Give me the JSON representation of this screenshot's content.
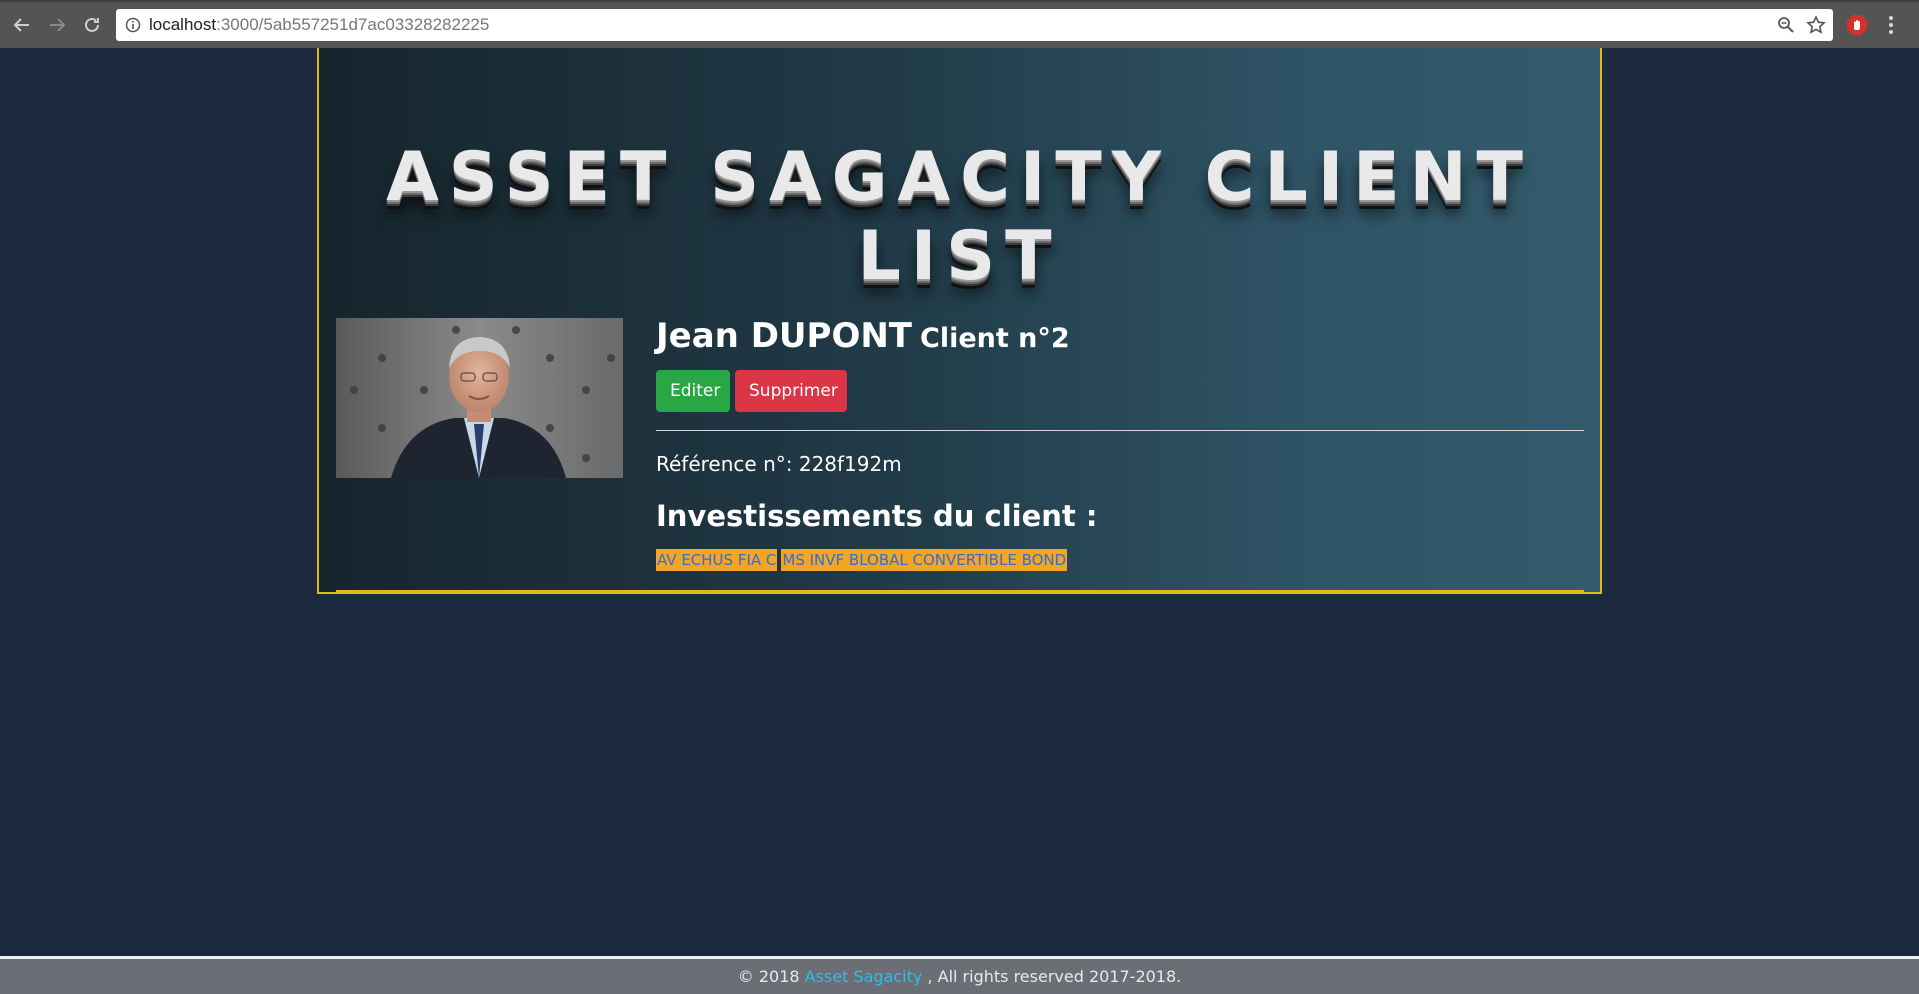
{
  "browser": {
    "url_host": "localhost",
    "url_path": ":3000/5ab557251d7ac03328282225"
  },
  "page": {
    "title": "ASSET SAGACITY CLIENT LIST"
  },
  "client": {
    "name": "Jean DUPONT",
    "number_label": "Client n°2",
    "edit_label": "Editer",
    "delete_label": "Supprimer",
    "reference": "Référence n°: 228f192m",
    "investments_title": "Investissements du client :",
    "investments": [
      "AV ECHUS FIA C",
      "MS INVF BLOBAL CONVERTIBLE BOND"
    ]
  },
  "footer": {
    "prefix": "© 2018 ",
    "link": "Asset Sagacity",
    "suffix": " , All rights reserved 2017-2018."
  },
  "colors": {
    "background": "#1b2a41",
    "frame": "#e3b816",
    "edit": "#28a745",
    "delete": "#dc3545",
    "tag": "#f4a623",
    "footer_link": "#29c0e6"
  }
}
